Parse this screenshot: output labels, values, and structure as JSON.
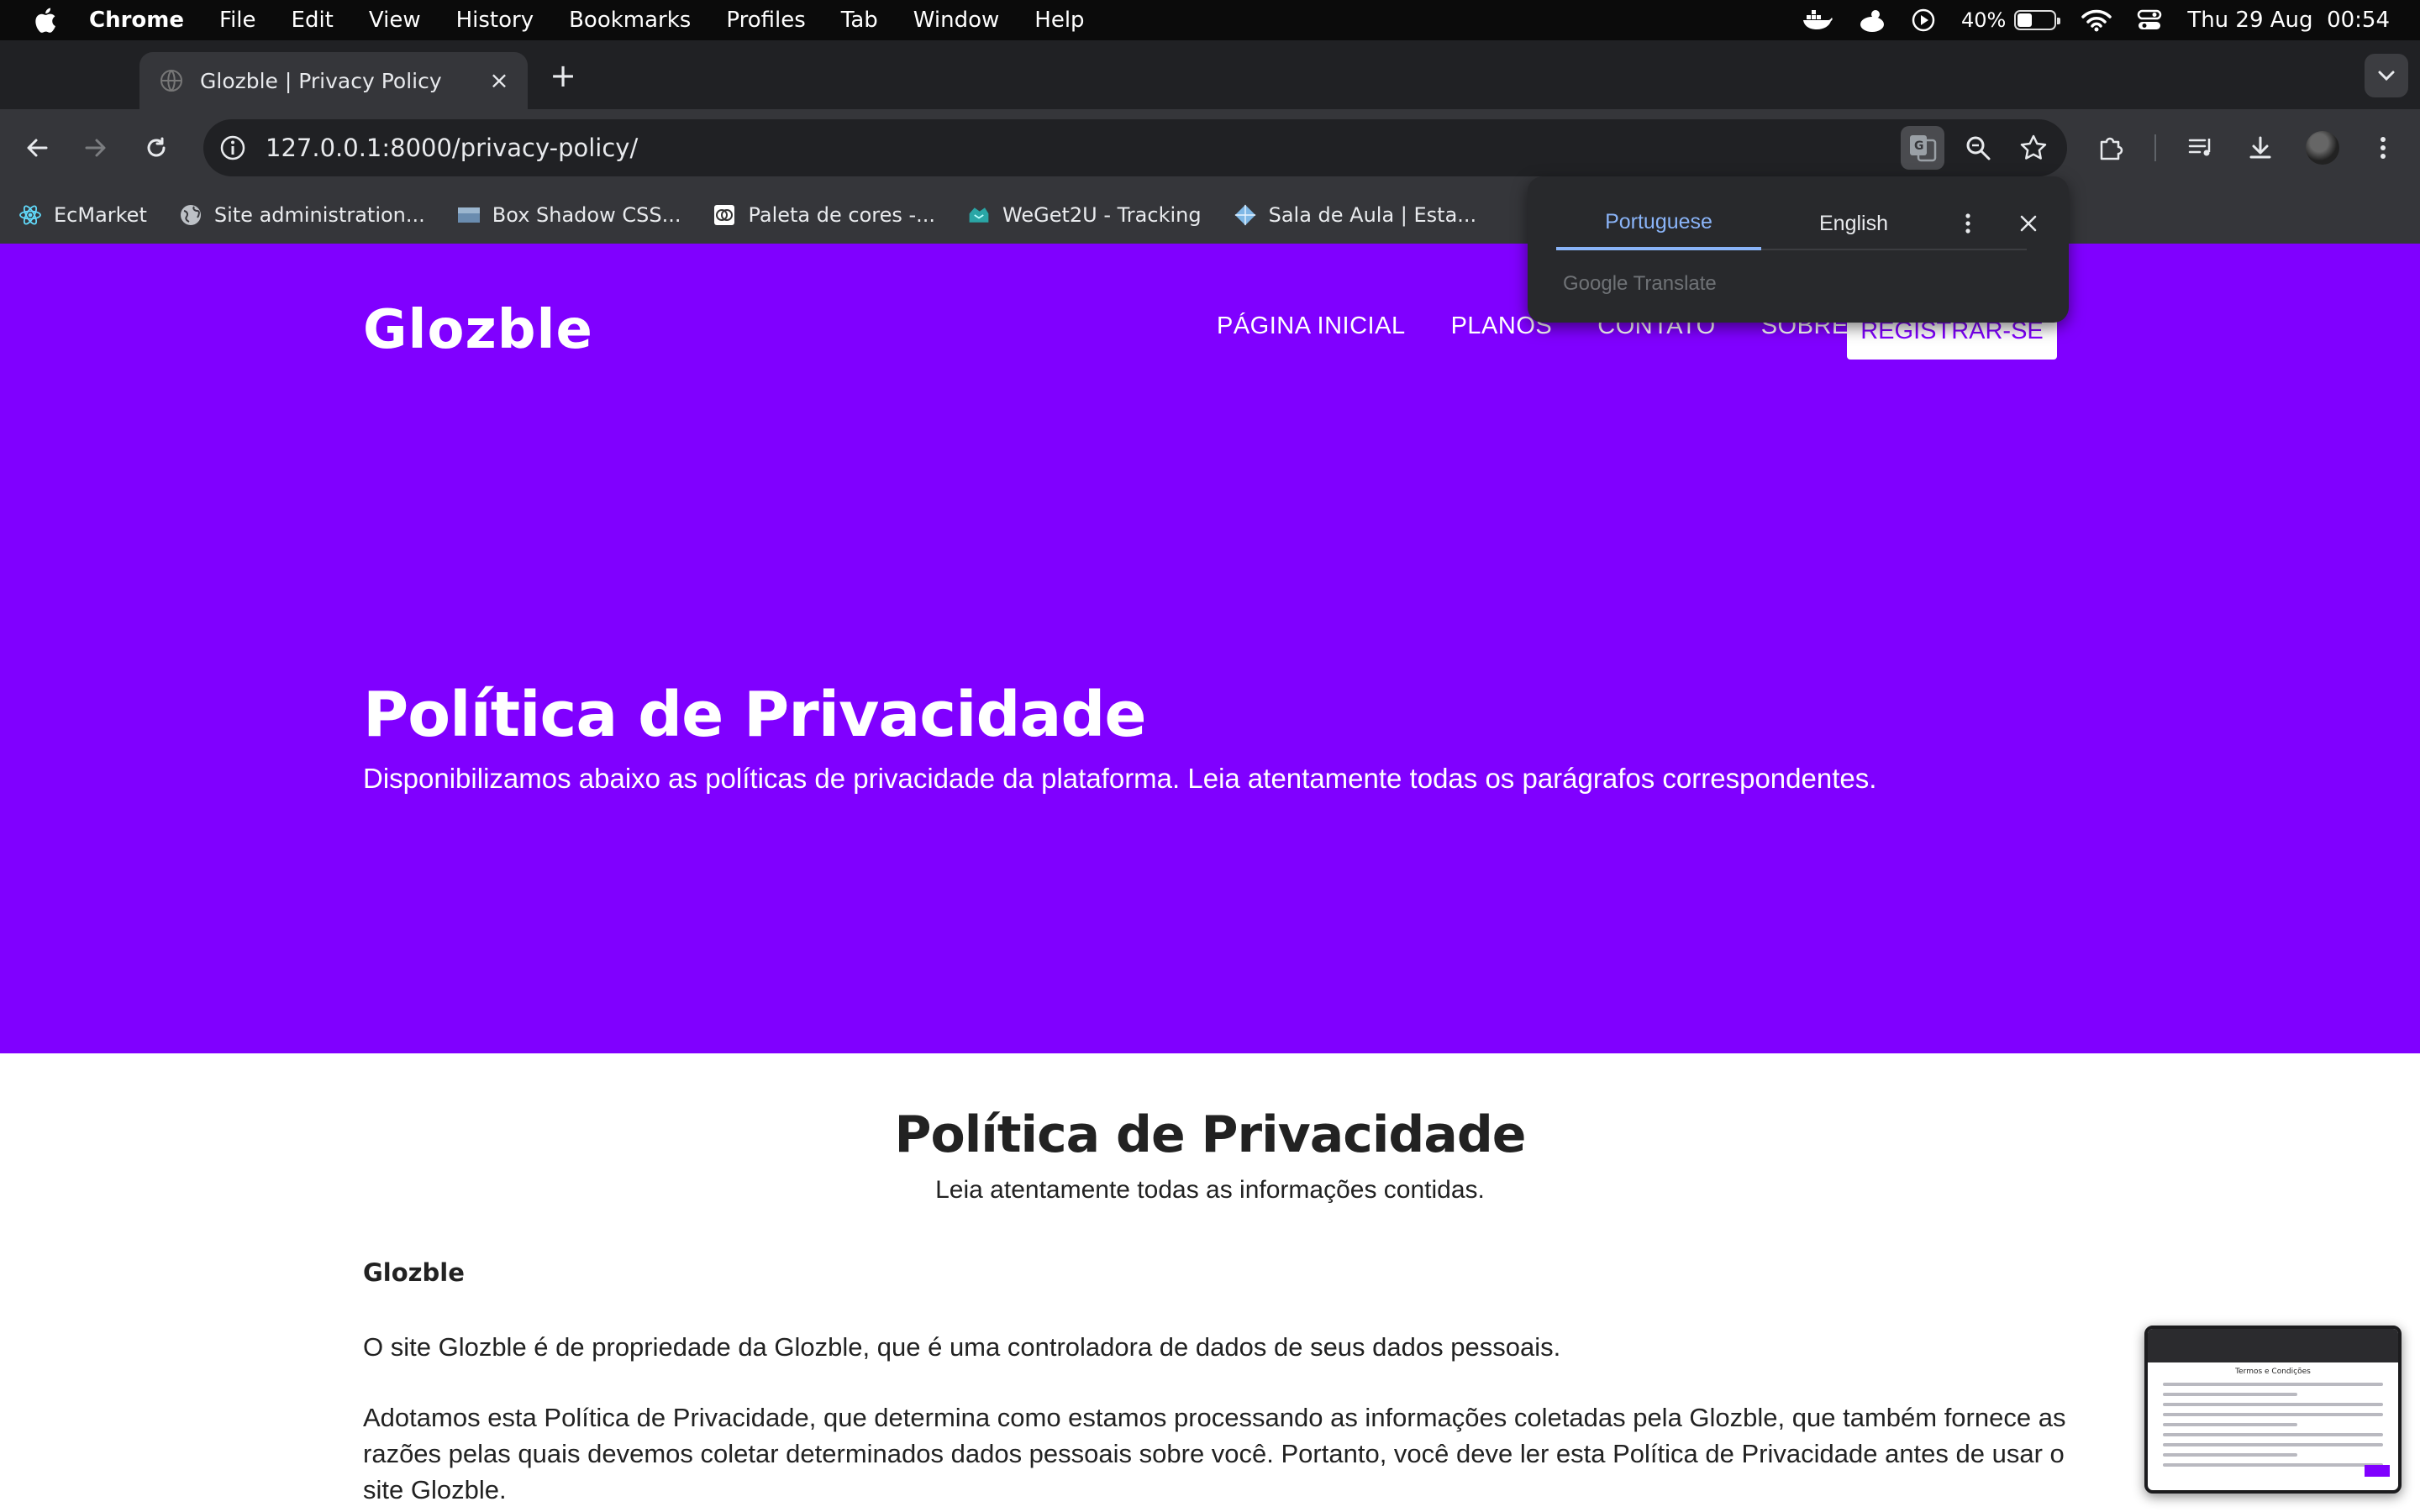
{
  "menubar": {
    "app_name": "Chrome",
    "items": [
      "File",
      "Edit",
      "View",
      "History",
      "Bookmarks",
      "Profiles",
      "Tab",
      "Window",
      "Help"
    ],
    "battery_percent": "40%",
    "battery_level": 0.4,
    "datetime": "Thu 29 Aug  00:54"
  },
  "tab": {
    "title": "Glozble | Privacy Policy",
    "favicon": "globe-icon"
  },
  "toolbar": {
    "url": "127.0.0.1:8000/privacy-policy/"
  },
  "bookmarks": [
    {
      "label": "EcMarket",
      "icon": "react-icon"
    },
    {
      "label": "Site administration...",
      "icon": "globe-icon"
    },
    {
      "label": "Box Shadow CSS...",
      "icon": "image-icon"
    },
    {
      "label": "Paleta de cores -...",
      "icon": "palette-icon"
    },
    {
      "label": "WeGet2U - Tracking",
      "icon": "package-icon"
    },
    {
      "label": "Sala de Aula | Esta...",
      "icon": "diamond-icon"
    }
  ],
  "translate_popup": {
    "tabs": [
      "Portuguese",
      "English"
    ],
    "active_tab": "Portuguese",
    "brand": "Google Translate"
  },
  "site": {
    "logo": "Glozble",
    "nav": [
      "PÁGINA INICIAL",
      "PLANOS",
      "CONTATO",
      "SOBRE"
    ],
    "register_label": "REGISTRAR-SE",
    "hero_title": "Política de Privacidade",
    "hero_subtitle": "Disponibilizamos abaixo as políticas de privacidade da plataforma. Leia atentamente todas os parágrafos correspondentes.",
    "content_title": "Política de Privacidade",
    "content_subtitle": "Leia atentamente todas as informações contidas.",
    "section_heading": "Glozble",
    "paragraphs": [
      "O site Glozble é de propriedade da Glozble, que é uma controladora de dados de seus dados pessoais.",
      "Adotamos esta Política de Privacidade, que determina como estamos processando as informações coletadas pela Glozble, que também fornece as razões pelas quais devemos coletar determinados dados pessoais sobre você. Portanto, você deve ler esta Política de Privacidade antes de usar o site Glozble."
    ],
    "brand_color": "#8000ff"
  },
  "thumbnail": {
    "title": "Termos e Condições"
  }
}
